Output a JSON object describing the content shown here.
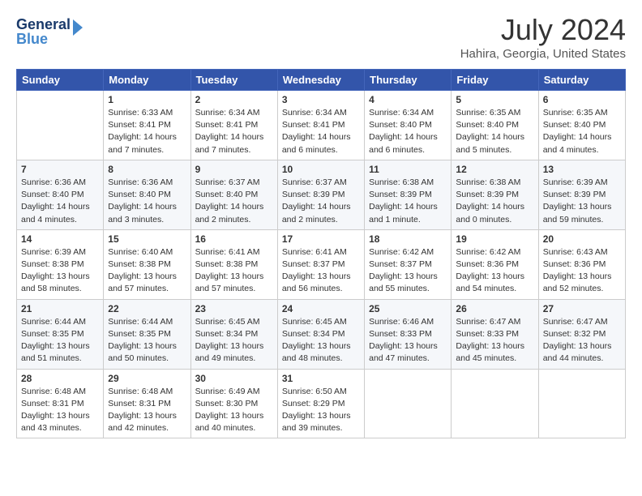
{
  "header": {
    "logo_line1": "General",
    "logo_line2": "Blue",
    "month_year": "July 2024",
    "location": "Hahira, Georgia, United States"
  },
  "days_of_week": [
    "Sunday",
    "Monday",
    "Tuesday",
    "Wednesday",
    "Thursday",
    "Friday",
    "Saturday"
  ],
  "weeks": [
    [
      {
        "day": "",
        "info": ""
      },
      {
        "day": "1",
        "info": "Sunrise: 6:33 AM\nSunset: 8:41 PM\nDaylight: 14 hours\nand 7 minutes."
      },
      {
        "day": "2",
        "info": "Sunrise: 6:34 AM\nSunset: 8:41 PM\nDaylight: 14 hours\nand 7 minutes."
      },
      {
        "day": "3",
        "info": "Sunrise: 6:34 AM\nSunset: 8:41 PM\nDaylight: 14 hours\nand 6 minutes."
      },
      {
        "day": "4",
        "info": "Sunrise: 6:34 AM\nSunset: 8:40 PM\nDaylight: 14 hours\nand 6 minutes."
      },
      {
        "day": "5",
        "info": "Sunrise: 6:35 AM\nSunset: 8:40 PM\nDaylight: 14 hours\nand 5 minutes."
      },
      {
        "day": "6",
        "info": "Sunrise: 6:35 AM\nSunset: 8:40 PM\nDaylight: 14 hours\nand 4 minutes."
      }
    ],
    [
      {
        "day": "7",
        "info": "Sunrise: 6:36 AM\nSunset: 8:40 PM\nDaylight: 14 hours\nand 4 minutes."
      },
      {
        "day": "8",
        "info": "Sunrise: 6:36 AM\nSunset: 8:40 PM\nDaylight: 14 hours\nand 3 minutes."
      },
      {
        "day": "9",
        "info": "Sunrise: 6:37 AM\nSunset: 8:40 PM\nDaylight: 14 hours\nand 2 minutes."
      },
      {
        "day": "10",
        "info": "Sunrise: 6:37 AM\nSunset: 8:39 PM\nDaylight: 14 hours\nand 2 minutes."
      },
      {
        "day": "11",
        "info": "Sunrise: 6:38 AM\nSunset: 8:39 PM\nDaylight: 14 hours\nand 1 minute."
      },
      {
        "day": "12",
        "info": "Sunrise: 6:38 AM\nSunset: 8:39 PM\nDaylight: 14 hours\nand 0 minutes."
      },
      {
        "day": "13",
        "info": "Sunrise: 6:39 AM\nSunset: 8:39 PM\nDaylight: 13 hours\nand 59 minutes."
      }
    ],
    [
      {
        "day": "14",
        "info": "Sunrise: 6:39 AM\nSunset: 8:38 PM\nDaylight: 13 hours\nand 58 minutes."
      },
      {
        "day": "15",
        "info": "Sunrise: 6:40 AM\nSunset: 8:38 PM\nDaylight: 13 hours\nand 57 minutes."
      },
      {
        "day": "16",
        "info": "Sunrise: 6:41 AM\nSunset: 8:38 PM\nDaylight: 13 hours\nand 57 minutes."
      },
      {
        "day": "17",
        "info": "Sunrise: 6:41 AM\nSunset: 8:37 PM\nDaylight: 13 hours\nand 56 minutes."
      },
      {
        "day": "18",
        "info": "Sunrise: 6:42 AM\nSunset: 8:37 PM\nDaylight: 13 hours\nand 55 minutes."
      },
      {
        "day": "19",
        "info": "Sunrise: 6:42 AM\nSunset: 8:36 PM\nDaylight: 13 hours\nand 54 minutes."
      },
      {
        "day": "20",
        "info": "Sunrise: 6:43 AM\nSunset: 8:36 PM\nDaylight: 13 hours\nand 52 minutes."
      }
    ],
    [
      {
        "day": "21",
        "info": "Sunrise: 6:44 AM\nSunset: 8:35 PM\nDaylight: 13 hours\nand 51 minutes."
      },
      {
        "day": "22",
        "info": "Sunrise: 6:44 AM\nSunset: 8:35 PM\nDaylight: 13 hours\nand 50 minutes."
      },
      {
        "day": "23",
        "info": "Sunrise: 6:45 AM\nSunset: 8:34 PM\nDaylight: 13 hours\nand 49 minutes."
      },
      {
        "day": "24",
        "info": "Sunrise: 6:45 AM\nSunset: 8:34 PM\nDaylight: 13 hours\nand 48 minutes."
      },
      {
        "day": "25",
        "info": "Sunrise: 6:46 AM\nSunset: 8:33 PM\nDaylight: 13 hours\nand 47 minutes."
      },
      {
        "day": "26",
        "info": "Sunrise: 6:47 AM\nSunset: 8:33 PM\nDaylight: 13 hours\nand 45 minutes."
      },
      {
        "day": "27",
        "info": "Sunrise: 6:47 AM\nSunset: 8:32 PM\nDaylight: 13 hours\nand 44 minutes."
      }
    ],
    [
      {
        "day": "28",
        "info": "Sunrise: 6:48 AM\nSunset: 8:31 PM\nDaylight: 13 hours\nand 43 minutes."
      },
      {
        "day": "29",
        "info": "Sunrise: 6:48 AM\nSunset: 8:31 PM\nDaylight: 13 hours\nand 42 minutes."
      },
      {
        "day": "30",
        "info": "Sunrise: 6:49 AM\nSunset: 8:30 PM\nDaylight: 13 hours\nand 40 minutes."
      },
      {
        "day": "31",
        "info": "Sunrise: 6:50 AM\nSunset: 8:29 PM\nDaylight: 13 hours\nand 39 minutes."
      },
      {
        "day": "",
        "info": ""
      },
      {
        "day": "",
        "info": ""
      },
      {
        "day": "",
        "info": ""
      }
    ]
  ]
}
